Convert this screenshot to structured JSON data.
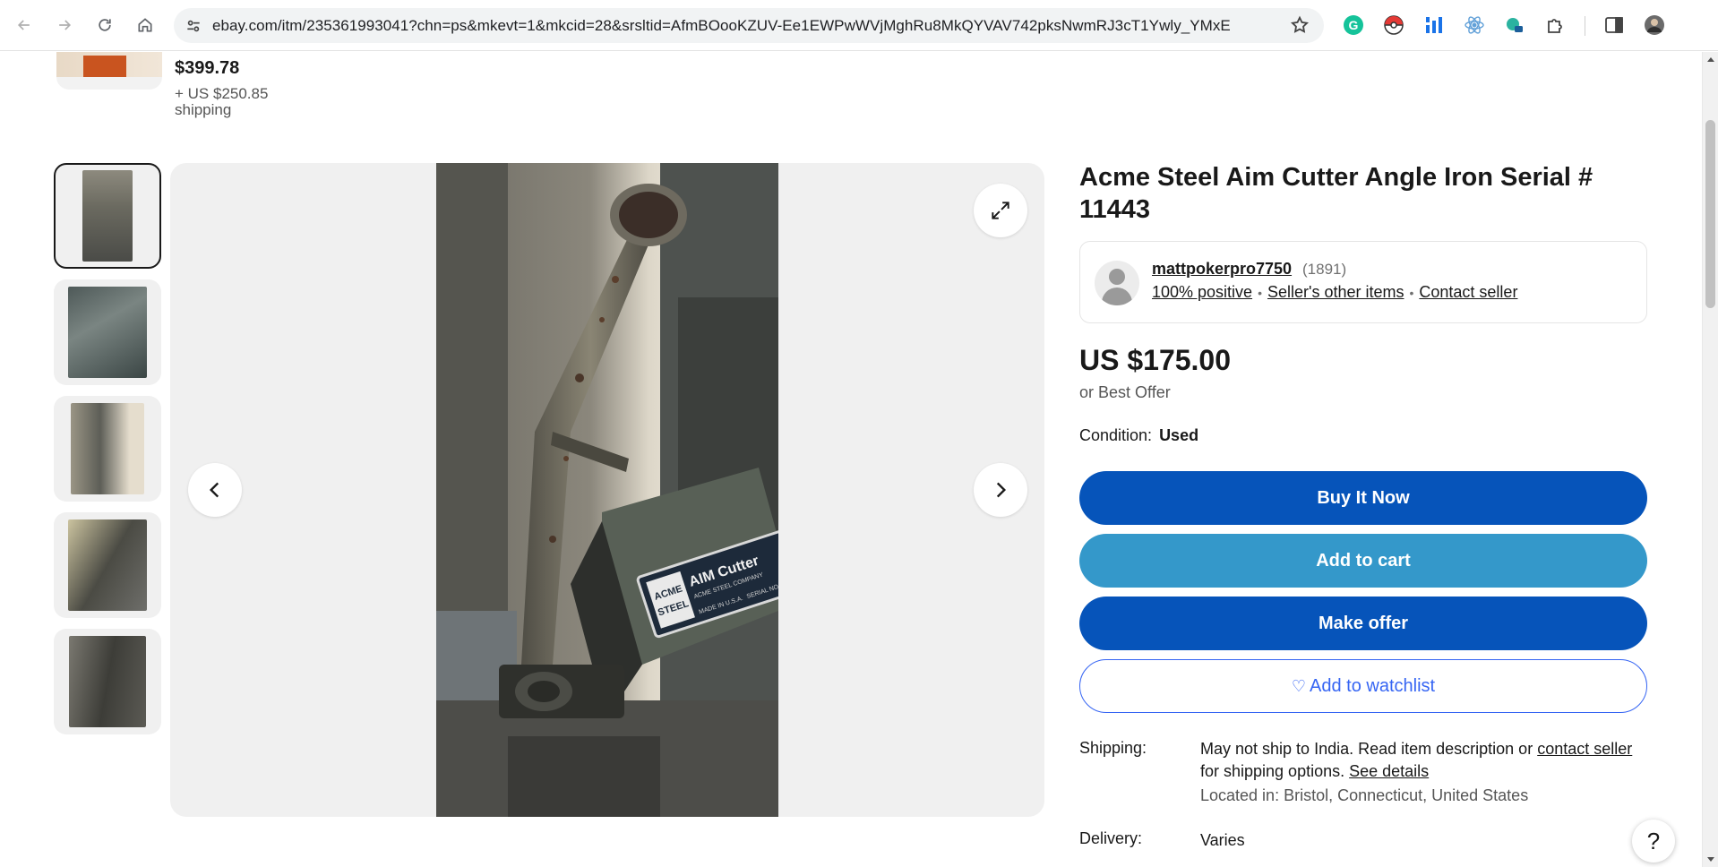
{
  "browser": {
    "url": "ebay.com/itm/235361993041?chn=ps&mkevt=1&mkcid=28&srsltid=AfmBOooKZUV-Ee1EWPwWVjMghRu8MkQYVAV742pksNwmRJ3cT1Ywly_YMxE",
    "extensions": [
      "grammarly-icon",
      "pokeball-icon",
      "analytics-icon",
      "react-icon",
      "edge-tool-icon",
      "puzzle-icon"
    ]
  },
  "related_item": {
    "price": "$399.78",
    "shipping": "+ US $250.85 shipping"
  },
  "listing": {
    "title": "Acme Steel Aim Cutter Angle Iron Serial # 11443",
    "seller": {
      "name": "mattpokerpro7750",
      "feedback_count": "(1891)",
      "positive": "100% positive",
      "other_items": "Seller's other items",
      "contact": "Contact seller"
    },
    "price": "US $175.00",
    "best_offer": "or Best Offer",
    "condition_label": "Condition:",
    "condition_value": "Used",
    "buttons": {
      "buy": "Buy It Now",
      "cart": "Add to cart",
      "offer": "Make offer",
      "watch": "Add to watchlist"
    },
    "shipping_label": "Shipping:",
    "shipping_text_1": "May not ship to India. Read item description or",
    "shipping_link_contact": "contact seller",
    "shipping_text_2": "for shipping options.",
    "shipping_link_details": "See details",
    "located": "Located in: Bristol, Connecticut, United States",
    "delivery_label": "Delivery:",
    "delivery_value": "Varies"
  },
  "help_label": "?",
  "plate_text": {
    "brand_top": "ACME",
    "brand_bottom": "STEEL",
    "product": "AIM Cutter",
    "company": "ACME STEEL COMPANY",
    "made_in": "MADE IN U.S.A.",
    "serial": "SERIAL NO."
  }
}
